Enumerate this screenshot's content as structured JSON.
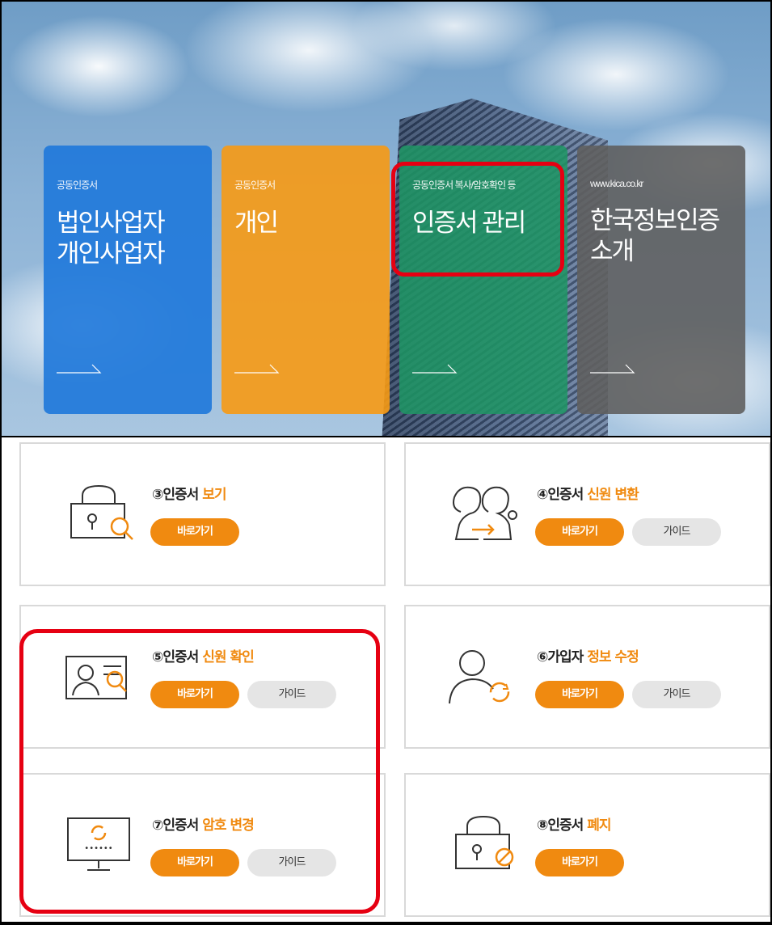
{
  "hero": {
    "cards": [
      {
        "small": "공동인증서",
        "big": "법인사업자\n개인사업자",
        "color": "#217ada"
      },
      {
        "small": "공동인증서",
        "big": "개인",
        "color": "#f79a14"
      },
      {
        "small": "공동인증서 복사/암호확인 등",
        "big": "인증서 관리",
        "color": "#1e9664"
      },
      {
        "small": "www.kica.co.kr",
        "big": "한국정보인증\n소개",
        "color": "#5f5f5f"
      }
    ]
  },
  "panels": [
    {
      "num": "③",
      "prefix": "인증서",
      "accent": "보기",
      "icon": "lock-search-icon",
      "go": "바로가기",
      "guide": null
    },
    {
      "num": "④",
      "prefix": "인증서",
      "accent": "신원 변환",
      "icon": "people-transfer-icon",
      "go": "바로가기",
      "guide": "가이드"
    },
    {
      "num": "⑤",
      "prefix": "인증서",
      "accent": "신원 확인",
      "icon": "id-card-search-icon",
      "go": "바로가기",
      "guide": "가이드"
    },
    {
      "num": "⑥",
      "prefix": "가입자",
      "accent": "정보 수정",
      "icon": "user-refresh-icon",
      "go": "바로가기",
      "guide": "가이드"
    },
    {
      "num": "⑦",
      "prefix": "인증서",
      "accent": "암호 변경",
      "icon": "monitor-password-icon",
      "go": "바로가기",
      "guide": "가이드"
    },
    {
      "num": "⑧",
      "prefix": "인증서",
      "accent": "폐지",
      "icon": "lock-revoke-icon",
      "go": "바로가기",
      "guide": null
    }
  ],
  "colors": {
    "accent": "#f08a10",
    "highlight": "#e60012",
    "guide_bg": "#e5e5e5"
  }
}
